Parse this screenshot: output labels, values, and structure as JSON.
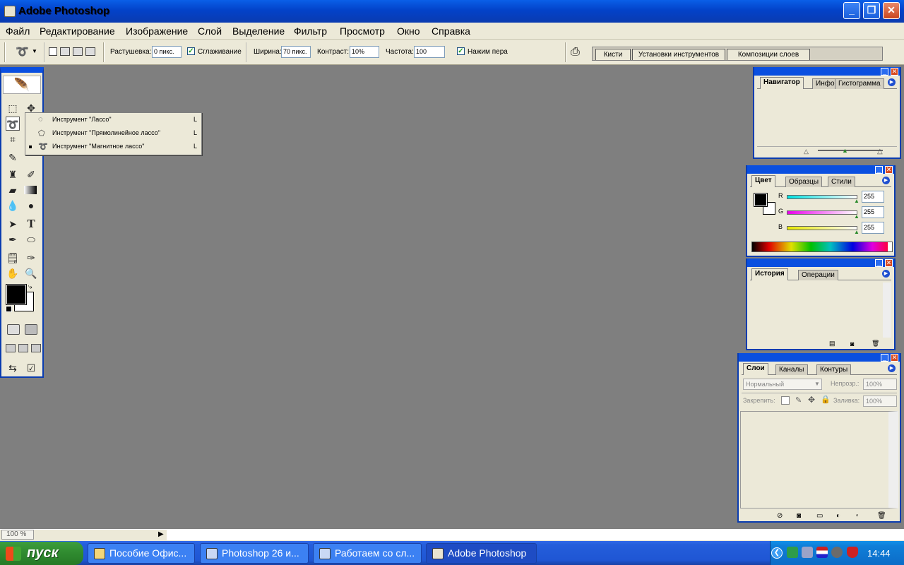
{
  "window": {
    "title": "Adobe Photoshop"
  },
  "menu": [
    "Файл",
    "Редактирование",
    "Изображение",
    "Слой",
    "Выделение",
    "Фильтр",
    "Просмотр",
    "Окно",
    "Справка"
  ],
  "options": {
    "feather_label": "Растушевка:",
    "feather_value": "0 пикс.",
    "antialias_label": "Сглаживание",
    "width_label": "Ширина:",
    "width_value": "70 пикс.",
    "contrast_label": "Контраст:",
    "contrast_value": "10%",
    "frequency_label": "Частота:",
    "frequency_value": "100",
    "pressure_label": "Нажим пера",
    "well_tabs": [
      "Кисти",
      "Установки инструментов",
      "Композиции слоев"
    ]
  },
  "flyout": {
    "items": [
      {
        "label": "Инструмент \"Лассо\"",
        "key": "L"
      },
      {
        "label": "Инструмент \"Прямолинейное лассо\"",
        "key": "L"
      },
      {
        "label": "Инструмент \"Магнитное лассо\"",
        "key": "L"
      }
    ]
  },
  "navigator_panel": {
    "tabs": [
      "Навигатор",
      "Инфо",
      "Гистограмма"
    ]
  },
  "color_panel": {
    "tabs": [
      "Цвет",
      "Образцы",
      "Стили"
    ],
    "channels": [
      {
        "label": "R",
        "value": "255",
        "color": "#00d8d8"
      },
      {
        "label": "G",
        "value": "255",
        "color": "#e800e8"
      },
      {
        "label": "B",
        "value": "255",
        "color": "#e8e800"
      }
    ]
  },
  "history_panel": {
    "tabs": [
      "История",
      "Операции"
    ]
  },
  "layers_panel": {
    "tabs": [
      "Слои",
      "Каналы",
      "Контуры"
    ],
    "blend_mode": "Нормальный",
    "opacity_label": "Непрозр.:",
    "opacity_value": "100%",
    "lock_label": "Закрепить:",
    "fill_label": "Заливка:",
    "fill_value": "100%"
  },
  "status": {
    "zoom": "100 %"
  },
  "taskbar": {
    "start_label": "пуск",
    "tasks": [
      "Пособие Офис...",
      "Photoshop 26 и...",
      "Работаем со сл...",
      "Adobe Photoshop"
    ],
    "clock": "14:44"
  },
  "colors": {
    "accent": "#0a4fe0",
    "canvas": "#7f7f7f",
    "chrome": "#ece9d8"
  }
}
